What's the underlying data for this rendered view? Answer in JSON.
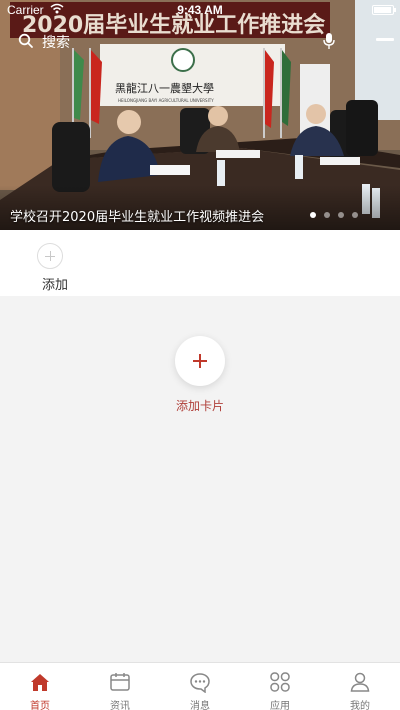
{
  "status_bar": {
    "carrier": "Carrier",
    "time": "9:43 AM",
    "battery_level": 0.95
  },
  "search": {
    "placeholder": "搜索"
  },
  "hero": {
    "banner_text": "2020届毕业生就业工作推进会",
    "sign_text": "黑龍江八一農墾大學",
    "sign_subtext": "HEILONGJIANG BAYI AGRICULTURAL UNIVERSITY",
    "caption": "学校召开2020届毕业生就业工作视频推进会",
    "slide_count": 4,
    "active_slide": 0
  },
  "quick_add": {
    "label": "添加"
  },
  "add_card": {
    "label": "添加卡片"
  },
  "tabbar": {
    "items": [
      {
        "label": "首页",
        "icon": "home-icon",
        "active": true
      },
      {
        "label": "资讯",
        "icon": "news-icon",
        "active": false
      },
      {
        "label": "消息",
        "icon": "message-icon",
        "active": false
      },
      {
        "label": "应用",
        "icon": "apps-icon",
        "active": false
      },
      {
        "label": "我的",
        "icon": "profile-icon",
        "active": false
      }
    ]
  },
  "colors": {
    "accent": "#c0392b",
    "tab_inactive": "#777777",
    "background": "#f3f3f3"
  }
}
